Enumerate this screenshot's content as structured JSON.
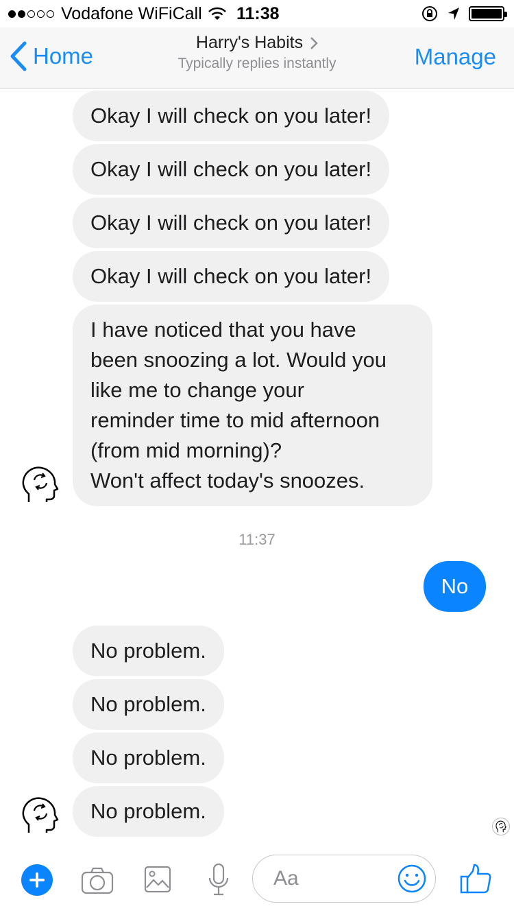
{
  "status_bar": {
    "carrier": "Vodafone WiFiCall",
    "time": "11:38"
  },
  "nav": {
    "back_label": "Home",
    "title": "Harry's Habits",
    "subtitle": "Typically replies instantly",
    "manage_label": "Manage"
  },
  "messages": {
    "received_1": "Okay I will check on you later!",
    "received_2": "Okay I will check on you later!",
    "received_3": "Okay I will check on you later!",
    "received_4": "Okay I will check on you later!",
    "received_5": "I have noticed that you have\nbeen snoozing a lot. Would you\nlike me to change your\nreminder time to mid afternoon\n(from mid morning)?\nWon't affect today's snoozes.",
    "timestamp": "11:37",
    "sent_1": "No",
    "received_6": "No problem.",
    "received_7": "No problem.",
    "received_8": "No problem.",
    "received_9": "No problem."
  },
  "composer": {
    "placeholder": "Aa"
  },
  "colors": {
    "accent": "#0a84ff",
    "link": "#1a8cf5",
    "bubble_received": "#f1f0f0"
  },
  "icons": {
    "back": "chevron-left-icon",
    "plus": "plus-icon",
    "camera": "camera-icon",
    "gallery": "image-icon",
    "mic": "microphone-icon",
    "emoji": "smiley-icon",
    "like": "thumbs-up-icon",
    "avatar": "head-refresh-icon"
  }
}
